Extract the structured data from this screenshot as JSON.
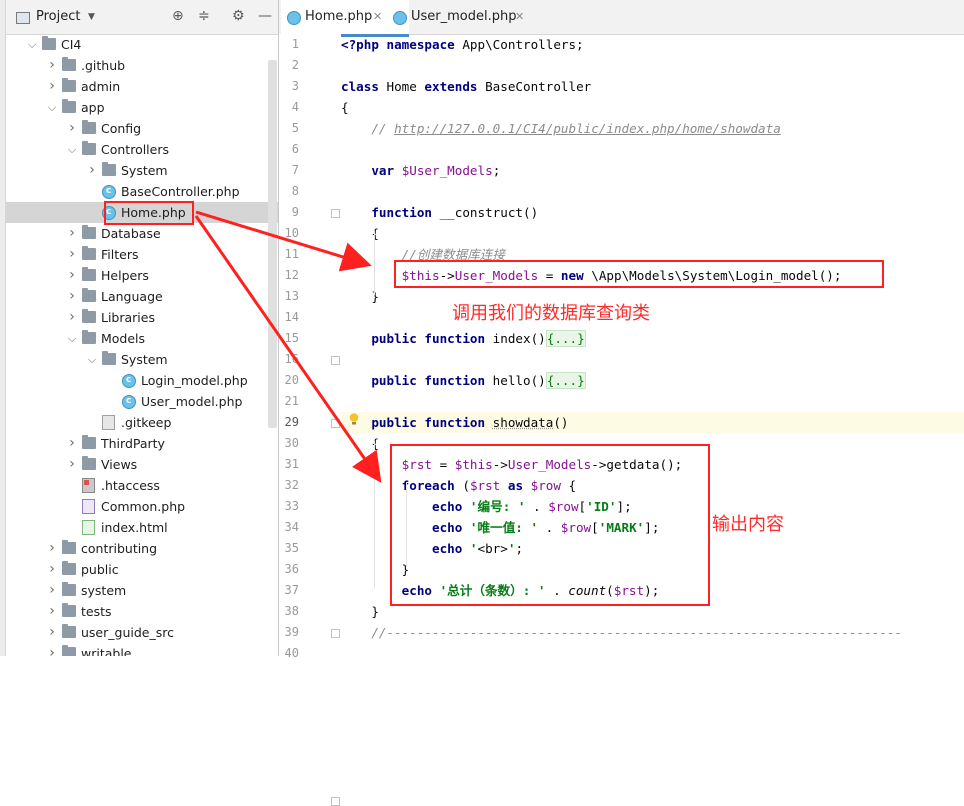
{
  "project_panel": {
    "title": "Project",
    "tree": [
      {
        "label": "CI4",
        "type": "folder",
        "depth": 0,
        "open": true
      },
      {
        "label": ".github",
        "type": "folder",
        "depth": 1,
        "open": false
      },
      {
        "label": "admin",
        "type": "folder",
        "depth": 1,
        "open": false
      },
      {
        "label": "app",
        "type": "folder",
        "depth": 1,
        "open": true
      },
      {
        "label": "Config",
        "type": "folder",
        "depth": 2,
        "open": false
      },
      {
        "label": "Controllers",
        "type": "folder",
        "depth": 2,
        "open": true
      },
      {
        "label": "System",
        "type": "folder",
        "depth": 3,
        "open": false
      },
      {
        "label": "BaseController.php",
        "type": "class",
        "depth": 3
      },
      {
        "label": "Home.php",
        "type": "class",
        "depth": 3,
        "selected": true
      },
      {
        "label": "Database",
        "type": "folder",
        "depth": 2,
        "open": false
      },
      {
        "label": "Filters",
        "type": "folder",
        "depth": 2,
        "open": false
      },
      {
        "label": "Helpers",
        "type": "folder",
        "depth": 2,
        "open": false
      },
      {
        "label": "Language",
        "type": "folder",
        "depth": 2,
        "open": false
      },
      {
        "label": "Libraries",
        "type": "folder",
        "depth": 2,
        "open": false
      },
      {
        "label": "Models",
        "type": "folder",
        "depth": 2,
        "open": true
      },
      {
        "label": "System",
        "type": "folder",
        "depth": 3,
        "open": true
      },
      {
        "label": "Login_model.php",
        "type": "class",
        "depth": 4
      },
      {
        "label": "User_model.php",
        "type": "class",
        "depth": 4
      },
      {
        "label": ".gitkeep",
        "type": "file",
        "depth": 3
      },
      {
        "label": "ThirdParty",
        "type": "folder",
        "depth": 2,
        "open": false
      },
      {
        "label": "Views",
        "type": "folder",
        "depth": 2,
        "open": false
      },
      {
        "label": ".htaccess",
        "type": "htaccess",
        "depth": 2
      },
      {
        "label": "Common.php",
        "type": "php",
        "depth": 2
      },
      {
        "label": "index.html",
        "type": "html",
        "depth": 2
      },
      {
        "label": "contributing",
        "type": "folder",
        "depth": 1,
        "open": false
      },
      {
        "label": "public",
        "type": "folder",
        "depth": 1,
        "open": false
      },
      {
        "label": "system",
        "type": "folder",
        "depth": 1,
        "open": false
      },
      {
        "label": "tests",
        "type": "folder",
        "depth": 1,
        "open": false
      },
      {
        "label": "user_guide_src",
        "type": "folder",
        "depth": 1,
        "open": false
      },
      {
        "label": "writable",
        "type": "folder",
        "depth": 1,
        "open": false
      }
    ]
  },
  "tabs": [
    {
      "label": "Home.php",
      "active": true
    },
    {
      "label": "User_model.php",
      "active": false
    }
  ],
  "editor": {
    "current_line": 29,
    "lines": [
      {
        "n": 1,
        "segs": [
          [
            "kb",
            "<?php "
          ],
          [
            "kb",
            "namespace "
          ],
          [
            "",
            "App\\Controllers;"
          ]
        ]
      },
      {
        "n": 2,
        "segs": []
      },
      {
        "n": 3,
        "segs": [
          [
            "kb",
            "class "
          ],
          [
            "",
            "Home "
          ],
          [
            "kb",
            "extends "
          ],
          [
            "",
            "BaseController"
          ]
        ]
      },
      {
        "n": 4,
        "segs": [
          [
            "",
            "{"
          ]
        ]
      },
      {
        "n": 5,
        "segs": [
          [
            "",
            "    "
          ],
          [
            "cmt",
            "// "
          ],
          [
            "url",
            "http://127.0.0.1/CI4/public/index.php/home/showdata"
          ]
        ]
      },
      {
        "n": 6,
        "segs": []
      },
      {
        "n": 7,
        "segs": [
          [
            "",
            "    "
          ],
          [
            "kb",
            "var "
          ],
          [
            "var",
            "$User_Models"
          ],
          [
            "",
            ";"
          ]
        ]
      },
      {
        "n": 8,
        "segs": []
      },
      {
        "n": 9,
        "segs": [
          [
            "",
            "    "
          ],
          [
            "kb",
            "function "
          ],
          [
            "",
            "__construct()"
          ]
        ]
      },
      {
        "n": 10,
        "segs": [
          [
            "",
            "    {"
          ]
        ]
      },
      {
        "n": 11,
        "segs": [
          [
            "",
            "        "
          ],
          [
            "cmt",
            "//创建数据库连接"
          ]
        ]
      },
      {
        "n": 12,
        "segs": [
          [
            "",
            "        "
          ],
          [
            "var",
            "$this"
          ],
          [
            "",
            "->"
          ],
          [
            "var",
            "User_Models"
          ],
          [
            "",
            " = "
          ],
          [
            "kb",
            "new "
          ],
          [
            "",
            "\\App\\Models\\System\\Login_model();"
          ]
        ]
      },
      {
        "n": 13,
        "segs": [
          [
            "",
            "    }"
          ]
        ]
      },
      {
        "n": 14,
        "segs": []
      },
      {
        "n": 15,
        "segs": [
          [
            "",
            "    "
          ],
          [
            "kb",
            "public function "
          ],
          [
            "",
            "index()"
          ],
          [
            "fld",
            "{...}"
          ]
        ]
      },
      {
        "n": 16,
        "segs": []
      },
      {
        "n": 20,
        "segs": [
          [
            "",
            "    "
          ],
          [
            "kb",
            "public function "
          ],
          [
            "",
            "hello()"
          ],
          [
            "fld",
            "{...}"
          ]
        ]
      },
      {
        "n": 21,
        "segs": []
      },
      {
        "n": 29,
        "segs": [
          [
            "",
            "    "
          ],
          [
            "kb",
            "public function "
          ],
          [
            "unused",
            "showdata"
          ],
          [
            "",
            "()"
          ]
        ]
      },
      {
        "n": 30,
        "segs": [
          [
            "",
            "    {"
          ]
        ]
      },
      {
        "n": 31,
        "segs": [
          [
            "",
            "        "
          ],
          [
            "var",
            "$rst"
          ],
          [
            "",
            " = "
          ],
          [
            "var",
            "$this"
          ],
          [
            "",
            "->"
          ],
          [
            "var",
            "User_Models"
          ],
          [
            "",
            "->getdata();"
          ]
        ]
      },
      {
        "n": 32,
        "segs": [
          [
            "",
            "        "
          ],
          [
            "kb",
            "foreach "
          ],
          [
            "",
            "("
          ],
          [
            "var",
            "$rst "
          ],
          [
            "kb",
            "as "
          ],
          [
            "var",
            "$row"
          ],
          [
            "",
            " {"
          ]
        ]
      },
      {
        "n": 33,
        "segs": [
          [
            "",
            "            "
          ],
          [
            "kb",
            "echo "
          ],
          [
            "str",
            "'编号: '"
          ],
          [
            "",
            " . "
          ],
          [
            "var",
            "$row"
          ],
          [
            "",
            "["
          ],
          [
            "str",
            "'ID'"
          ],
          [
            "",
            "];"
          ]
        ]
      },
      {
        "n": 34,
        "segs": [
          [
            "",
            "            "
          ],
          [
            "kb",
            "echo "
          ],
          [
            "str",
            "'唯一值: '"
          ],
          [
            "",
            " . "
          ],
          [
            "var",
            "$row"
          ],
          [
            "",
            "["
          ],
          [
            "str",
            "'MARK'"
          ],
          [
            "",
            "];"
          ]
        ]
      },
      {
        "n": 35,
        "segs": [
          [
            "",
            "            "
          ],
          [
            "kb",
            "echo "
          ],
          [
            "str",
            "'"
          ],
          [
            "",
            "<br>"
          ],
          [
            "str",
            "'"
          ],
          [
            "",
            ";"
          ]
        ]
      },
      {
        "n": 36,
        "segs": [
          [
            "",
            "        }"
          ]
        ]
      },
      {
        "n": 37,
        "segs": [
          [
            "",
            "        "
          ],
          [
            "kb",
            "echo "
          ],
          [
            "str",
            "'总计（条数）: '"
          ],
          [
            "",
            " . "
          ],
          [
            "it",
            "count"
          ],
          [
            "",
            "("
          ],
          [
            "var",
            "$rst"
          ],
          [
            "",
            ");"
          ]
        ]
      },
      {
        "n": 38,
        "segs": [
          [
            "",
            "    }"
          ]
        ]
      },
      {
        "n": 39,
        "segs": [
          [
            "",
            "    "
          ],
          [
            "cmt",
            "//--------------------------------------------------------------------"
          ]
        ]
      },
      {
        "n": 40,
        "segs": []
      }
    ]
  },
  "annotations": {
    "db_call": "调用我们的数据库查询类",
    "output": "输出内容"
  },
  "colors": {
    "annotation": "#ff2020",
    "keyword": "#000080",
    "variable": "#871094",
    "string": "#067d17",
    "comment": "#8c8c8c"
  },
  "icons": [
    "project-icon",
    "locate-icon",
    "collapse-icon",
    "gear-icon",
    "minimize-icon",
    "folder-icon",
    "php-class-icon",
    "bulb-icon"
  ]
}
